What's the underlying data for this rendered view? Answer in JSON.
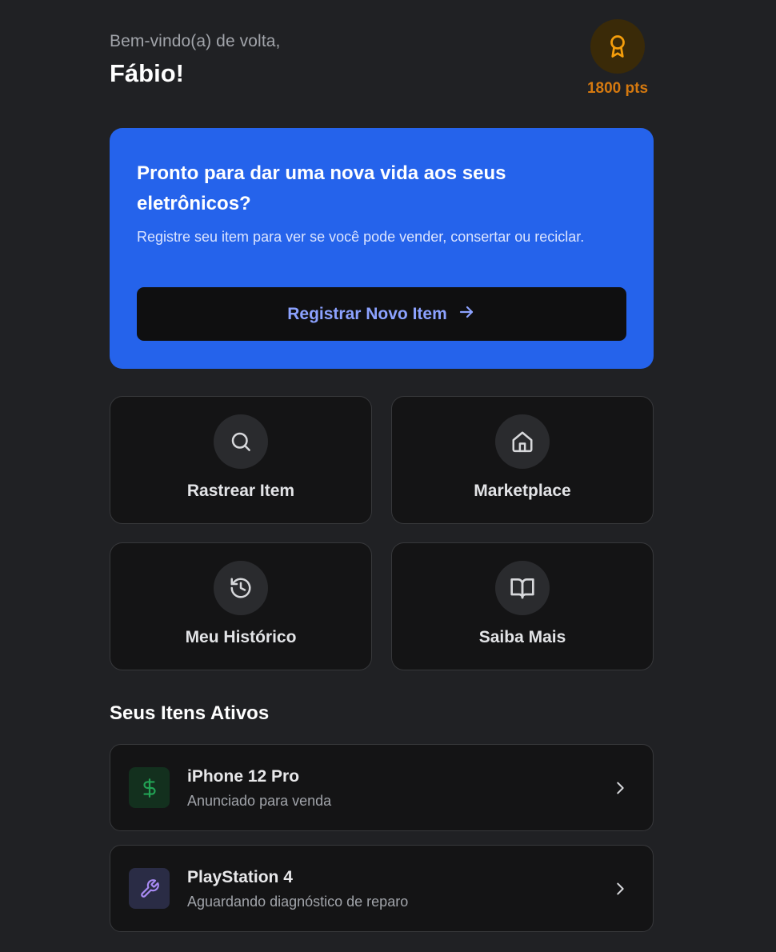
{
  "header": {
    "greeting": "Bem-vindo(a) de volta,",
    "username": "Fábio!",
    "points": "1800 pts",
    "points_icon": "award-icon",
    "points_color": "#d5790f"
  },
  "hero": {
    "title": "Pronto para dar uma nova vida aos seus eletrônicos?",
    "description": "Registre seu item para ver se você pode vender, consertar ou reciclar.",
    "button_label": "Registrar Novo Item",
    "button_icon": "arrow-right-icon",
    "background": "#2563eb"
  },
  "actions": [
    {
      "label": "Rastrear Item",
      "icon": "search-icon"
    },
    {
      "label": "Marketplace",
      "icon": "home-icon"
    },
    {
      "label": "Meu Histórico",
      "icon": "history-icon"
    },
    {
      "label": "Saiba Mais",
      "icon": "book-open-icon"
    }
  ],
  "active_items": {
    "title": "Seus Itens Ativos",
    "items": [
      {
        "name": "iPhone 12 Pro",
        "status": "Anunciado para venda",
        "icon": "dollar-icon",
        "icon_color": "#22a355"
      },
      {
        "name": "PlayStation 4",
        "status": "Aguardando diagnóstico de reparo",
        "icon": "wrench-icon",
        "icon_color": "#a98bf5"
      }
    ]
  }
}
